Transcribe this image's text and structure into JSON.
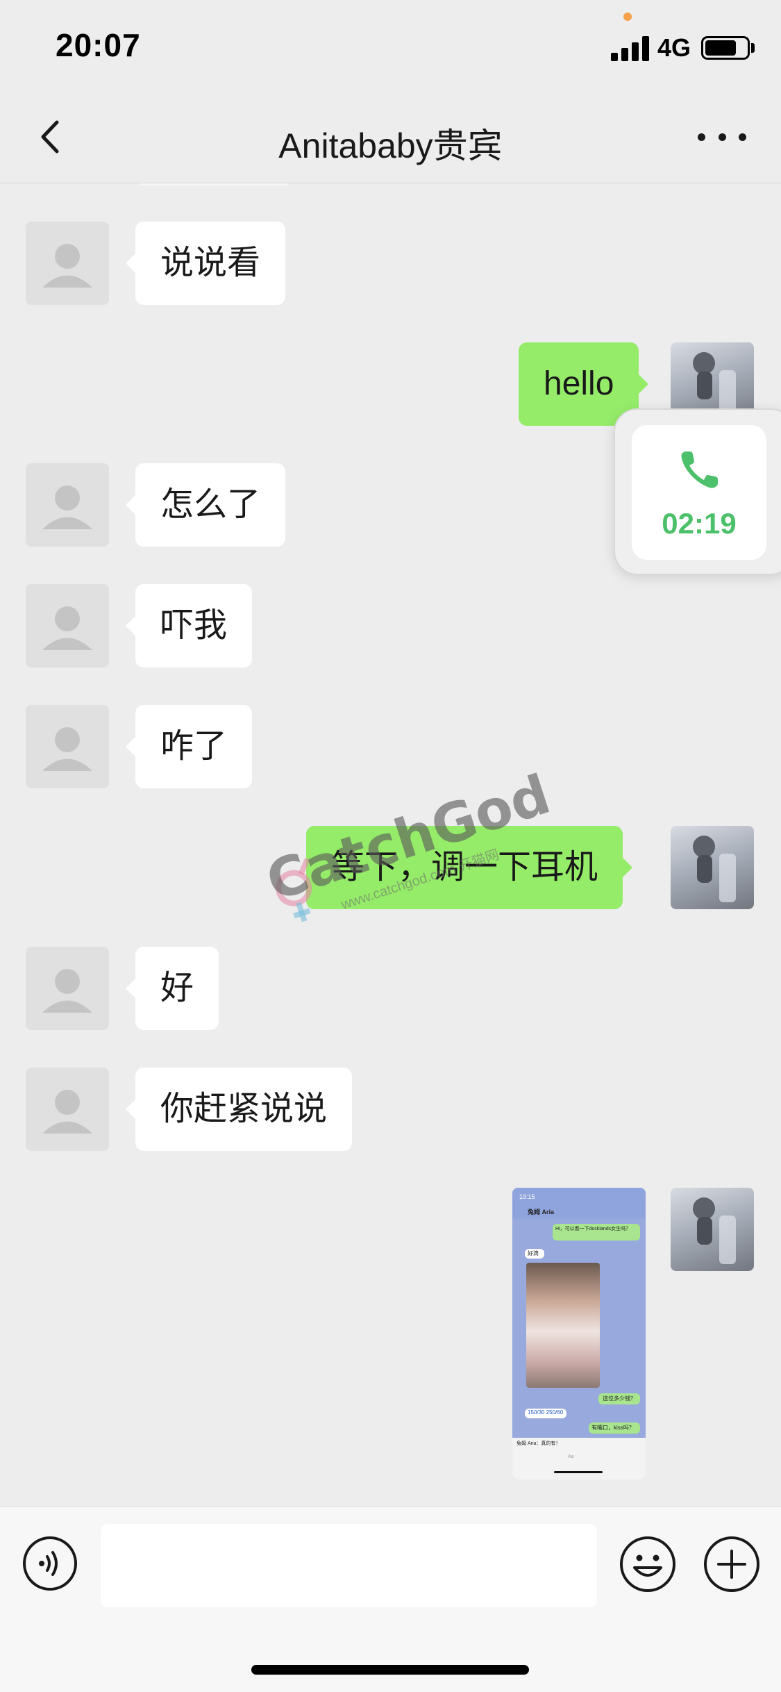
{
  "status_bar": {
    "time": "20:07",
    "network": "4G",
    "battery_level": 0.76,
    "indicator_color": "#f5a04a"
  },
  "nav": {
    "title": "Anitababy贵宾",
    "back_icon": "chevron-left-icon",
    "more_icon": "more-icon"
  },
  "messages": [
    {
      "side": "in",
      "type": "text",
      "text": "说说看"
    },
    {
      "side": "out",
      "type": "text",
      "text": "hello"
    },
    {
      "side": "in",
      "type": "text",
      "text": "怎么了"
    },
    {
      "side": "in",
      "type": "text",
      "text": "吓我"
    },
    {
      "side": "in",
      "type": "text",
      "text": "咋了"
    },
    {
      "side": "out",
      "type": "text",
      "text": "等下，调一下耳机"
    },
    {
      "side": "in",
      "type": "text",
      "text": "好"
    },
    {
      "side": "in",
      "type": "text",
      "text": "你赶紧说说"
    },
    {
      "side": "out",
      "type": "image"
    }
  ],
  "image_message": {
    "time": "19:15",
    "contact": "兔姆 Aria",
    "texts": [
      "Hi，可以看一下docklands女生吗？",
      "好滴",
      "這位多少钱？",
      "150/30 250/60",
      "有嘴口，kiss吗？",
      "兔姆 Aria：真的有！",
      "Aa"
    ]
  },
  "call_float": {
    "duration": "02:19",
    "icon": "phone-icon",
    "color": "#4cc06a"
  },
  "watermark": {
    "brand": "CatchGod",
    "url": "www.catchgod.com 开猫网"
  },
  "input_bar": {
    "value": "",
    "voice_icon": "voice-icon",
    "emoji_icon": "emoji-icon",
    "plus_icon": "plus-icon"
  },
  "colors": {
    "background": "#ededed",
    "incoming_bubble": "#ffffff",
    "outgoing_bubble": "#95ec69"
  }
}
